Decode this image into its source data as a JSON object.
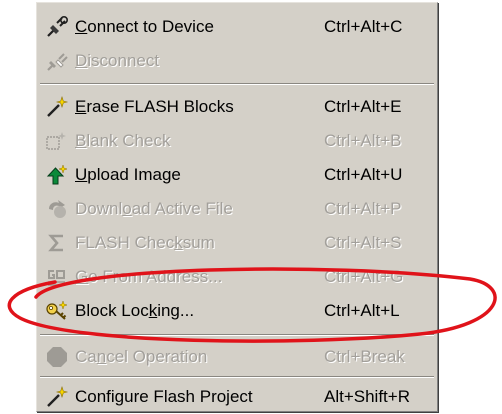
{
  "menu": {
    "items": [
      {
        "pre": "",
        "mn": "C",
        "post": "onnect to Device",
        "shortcut": "Ctrl+Alt+C",
        "icon": "plug-connect-icon",
        "enabled": true
      },
      {
        "pre": "",
        "mn": "D",
        "post": "isconnect",
        "shortcut": "",
        "icon": "plug-disconnect-icon",
        "enabled": false
      },
      {
        "pre": "",
        "mn": "E",
        "post": "rase FLASH Blocks",
        "shortcut": "Ctrl+Alt+E",
        "icon": "erase-wand-icon",
        "enabled": true
      },
      {
        "pre": "",
        "mn": "B",
        "post": "lank Check",
        "shortcut": "Ctrl+Alt+B",
        "icon": "blank-check-icon",
        "enabled": false
      },
      {
        "pre": "",
        "mn": "U",
        "post": "pload Image",
        "shortcut": "Ctrl+Alt+U",
        "icon": "upload-arrow-icon",
        "enabled": true
      },
      {
        "pre": "Downl",
        "mn": "o",
        "post": "ad Active File",
        "shortcut": "Ctrl+Alt+P",
        "icon": "download-icon",
        "enabled": false
      },
      {
        "pre": "FLASH Chec",
        "mn": "k",
        "post": "sum",
        "shortcut": "Ctrl+Alt+S",
        "icon": "sigma-icon",
        "enabled": false
      },
      {
        "pre": "",
        "mn": "G",
        "post": "o From Address...",
        "shortcut": "Ctrl+Alt+G",
        "icon": "go-icon",
        "enabled": false
      },
      {
        "pre": "Block Loc",
        "mn": "k",
        "post": "ing...",
        "shortcut": "Ctrl+Alt+L",
        "icon": "key-lock-icon",
        "enabled": true
      },
      {
        "pre": "Ca",
        "mn": "n",
        "post": "cel Operation",
        "shortcut": "Ctrl+Break",
        "icon": "stop-octagon-icon",
        "enabled": false
      },
      {
        "pre": "Configure Flash Project",
        "mn": "",
        "post": "",
        "shortcut": "Alt+Shift+R",
        "icon": "configure-wand-icon",
        "enabled": true
      }
    ]
  },
  "colors": {
    "menu_bg": "#d4d0c8",
    "disabled_text": "#a3a09b",
    "highlight_ellipse": "#e0131a"
  }
}
